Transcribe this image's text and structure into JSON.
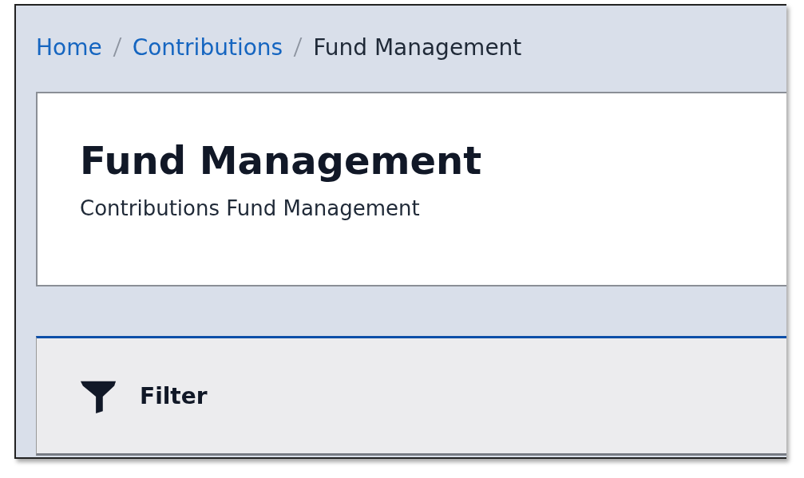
{
  "breadcrumb": [
    {
      "label": "Home",
      "kind": "link"
    },
    {
      "label": "Contributions",
      "kind": "link"
    },
    {
      "label": "Fund Management",
      "kind": "current"
    }
  ],
  "header": {
    "title": "Fund Management",
    "subtitle": "Contributions Fund Management"
  },
  "filter": {
    "label": "Filter"
  }
}
